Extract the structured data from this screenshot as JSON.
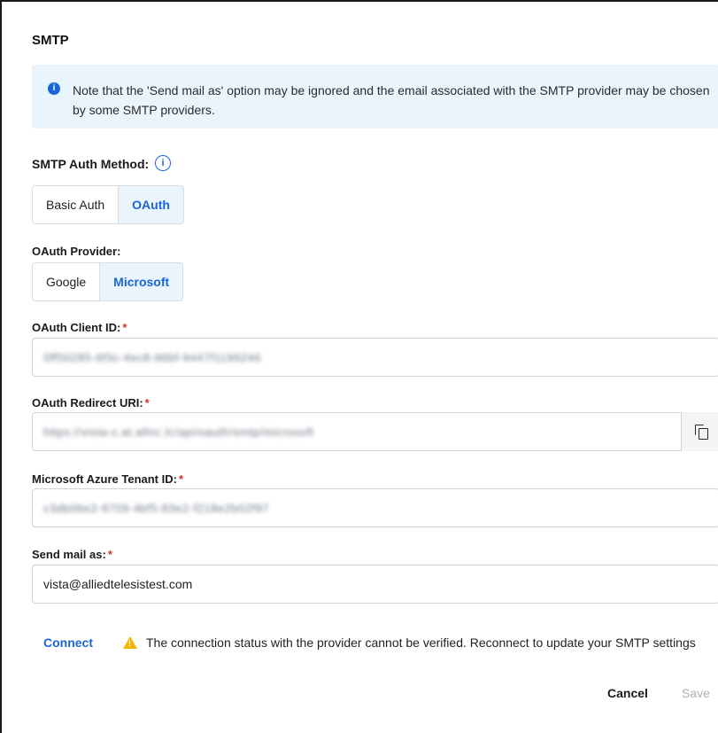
{
  "title": "SMTP",
  "banner": {
    "icon": "info-icon",
    "text": "Note that the 'Send mail as' option may be ignored and the email associated with the SMTP provider may be chosen by some SMTP providers."
  },
  "auth_method": {
    "label": "SMTP Auth Method:",
    "info_icon": "info-circle-icon",
    "options": [
      "Basic Auth",
      "OAuth"
    ],
    "selected": "OAuth"
  },
  "oauth_provider": {
    "label": "OAuth Provider:",
    "options": [
      "Google",
      "Microsoft"
    ],
    "selected": "Microsoft"
  },
  "client_id": {
    "label": "OAuth Client ID:",
    "required_mark": "*",
    "value": "0ff50285-6f3c-4ec8-96bf-9447f1199246"
  },
  "redirect_uri": {
    "label": "OAuth Redirect URI:",
    "required_mark": "*",
    "value": "https://vista-c.at.allnc.lc/api/oauth/smtp/microsoft",
    "copy_icon": "copy-icon"
  },
  "tenant_id": {
    "label": "Microsoft Azure Tenant ID:",
    "required_mark": "*",
    "value": "c3db06e2-9709-4bf5-83e2-f218e2b02f97"
  },
  "send_as": {
    "label": "Send mail as:",
    "required_mark": "*",
    "value": "vista@alliedtelesistest.com"
  },
  "connect_label": "Connect",
  "warning": {
    "icon": "warning-icon",
    "text": "The connection status with the provider cannot be verified. Reconnect to update your SMTP settings"
  },
  "actions": {
    "cancel": "Cancel",
    "save": "Save"
  },
  "colors": {
    "accent": "#1a66d6",
    "banner_bg": "#eaf4fd",
    "warning": "#f5b400",
    "required": "#d93025",
    "disabled": "#a9b0b8"
  }
}
